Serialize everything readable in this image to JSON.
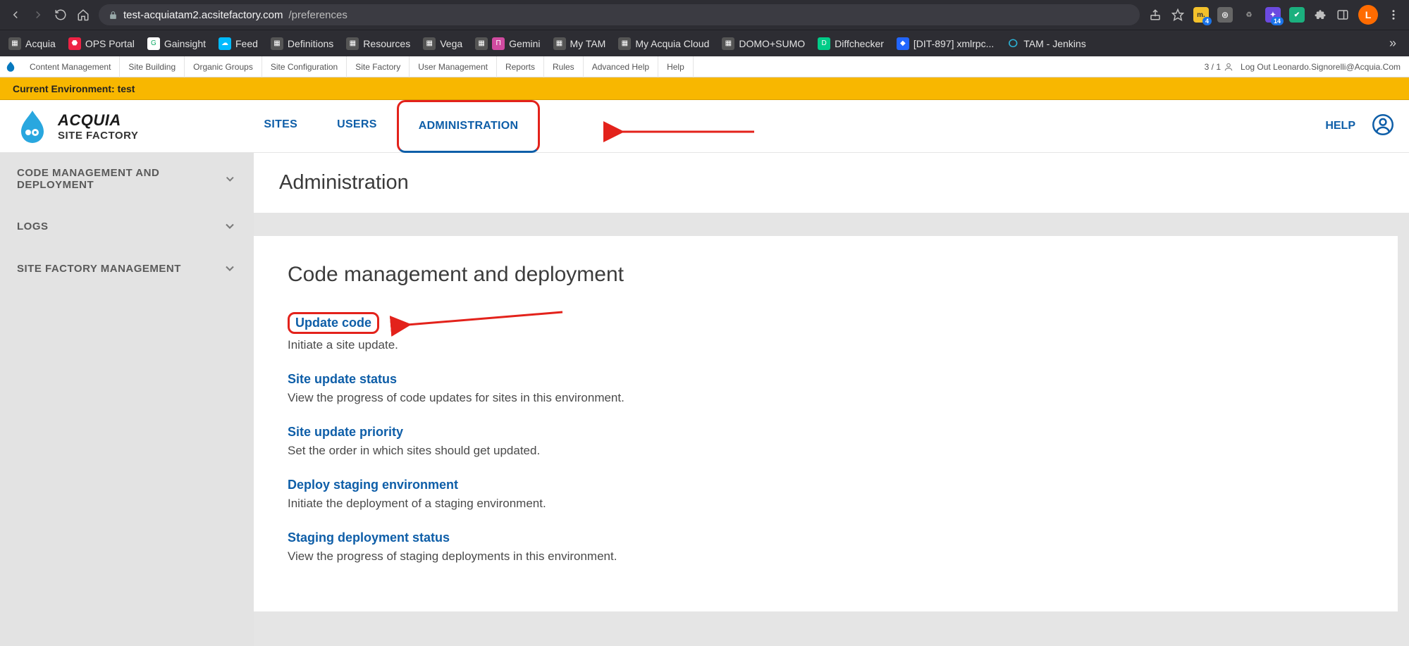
{
  "browser": {
    "url_host": "test-acquiatam2.acsitefactory.com",
    "url_path": "/preferences",
    "avatar_initial": "L",
    "ext_badge_1": "4",
    "ext_badge_2": "14"
  },
  "bookmarks": [
    {
      "label": "Acquia"
    },
    {
      "label": "OPS Portal"
    },
    {
      "label": "Gainsight"
    },
    {
      "label": "Feed"
    },
    {
      "label": "Definitions"
    },
    {
      "label": "Resources"
    },
    {
      "label": "Vega"
    },
    {
      "label": "Gemini"
    },
    {
      "label": "My TAM"
    },
    {
      "label": "My Acquia Cloud"
    },
    {
      "label": "DOMO+SUMO"
    },
    {
      "label": "Diffchecker"
    },
    {
      "label": "[DIT-897] xmlrpc..."
    },
    {
      "label": "TAM - Jenkins"
    }
  ],
  "bookmarks_overflow": "»",
  "admin_menu": {
    "items": [
      "Content Management",
      "Site Building",
      "Organic Groups",
      "Site Configuration",
      "Site Factory",
      "User Management",
      "Reports",
      "Rules",
      "Advanced Help",
      "Help"
    ],
    "count": "3 / 1",
    "logout": "Log Out Leonardo.Signorelli@Acquia.Com"
  },
  "env_bar": "Current Environment: test",
  "brand": {
    "line1": "ACQUIA",
    "line2": "SITE FACTORY"
  },
  "main_tabs": [
    {
      "label": "SITES",
      "active": false
    },
    {
      "label": "USERS",
      "active": false
    },
    {
      "label": "ADMINISTRATION",
      "active": true
    }
  ],
  "help_label": "HELP",
  "sidebar": [
    {
      "label": "CODE MANAGEMENT AND DEPLOYMENT"
    },
    {
      "label": "LOGS"
    },
    {
      "label": "SITE FACTORY MANAGEMENT"
    }
  ],
  "page_title": "Administration",
  "section_title": "Code management and deployment",
  "links": [
    {
      "title": "Update code",
      "desc": "Initiate a site update.",
      "boxed": true
    },
    {
      "title": "Site update status",
      "desc": "View the progress of code updates for sites in this environment.",
      "boxed": false
    },
    {
      "title": "Site update priority",
      "desc": "Set the order in which sites should get updated.",
      "boxed": false
    },
    {
      "title": "Deploy staging environment",
      "desc": "Initiate the deployment of a staging environment.",
      "boxed": false
    },
    {
      "title": "Staging deployment status",
      "desc": "View the progress of staging deployments in this environment.",
      "boxed": false
    }
  ]
}
